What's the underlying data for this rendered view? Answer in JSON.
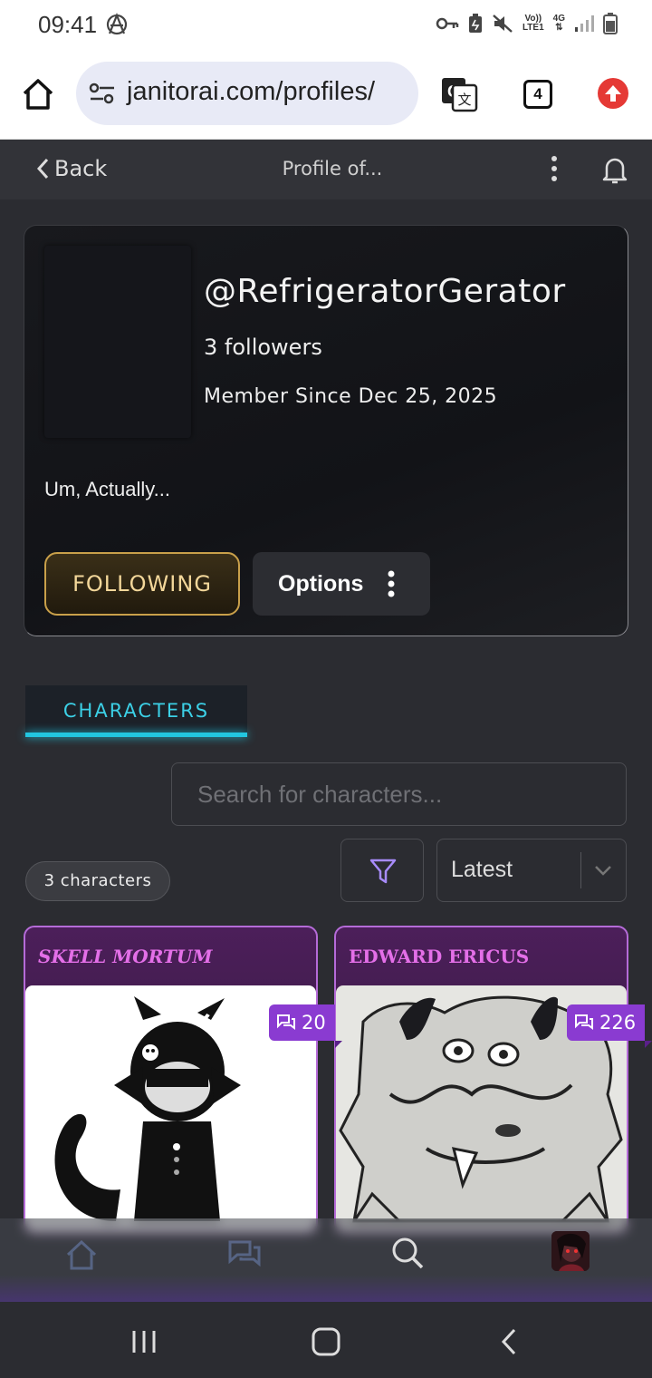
{
  "status_bar": {
    "time": "09:41",
    "network_top": "Vo))",
    "network_bottom": "LTE1",
    "data_type": "4G"
  },
  "browser": {
    "url": "janitorai.com/profiles/",
    "tab_count": "4"
  },
  "header": {
    "back_label": "Back",
    "title": "Profile of..."
  },
  "profile": {
    "username": "@RefrigeratorGerator",
    "followers": "3 followers",
    "member_since": "Member Since Dec 25, 2025",
    "bio": "Um, Actually...",
    "follow_label": "FOLLOWING",
    "options_label": "Options"
  },
  "tabs": [
    {
      "label": "CHARACTERS",
      "active": true
    }
  ],
  "search": {
    "placeholder": "Search for characters..."
  },
  "list_controls": {
    "count_label": "3 characters",
    "sort_selected": "Latest"
  },
  "characters": [
    {
      "name": "SKELL MORTUM",
      "chats": "20"
    },
    {
      "name": "EDWARD ERICUS",
      "chats": "226"
    }
  ],
  "colors": {
    "accent_cyan": "#22c6e0",
    "gold": "#c9a04a",
    "card_purple": "#b56bd8",
    "badge_purple": "#8a3bd1"
  }
}
